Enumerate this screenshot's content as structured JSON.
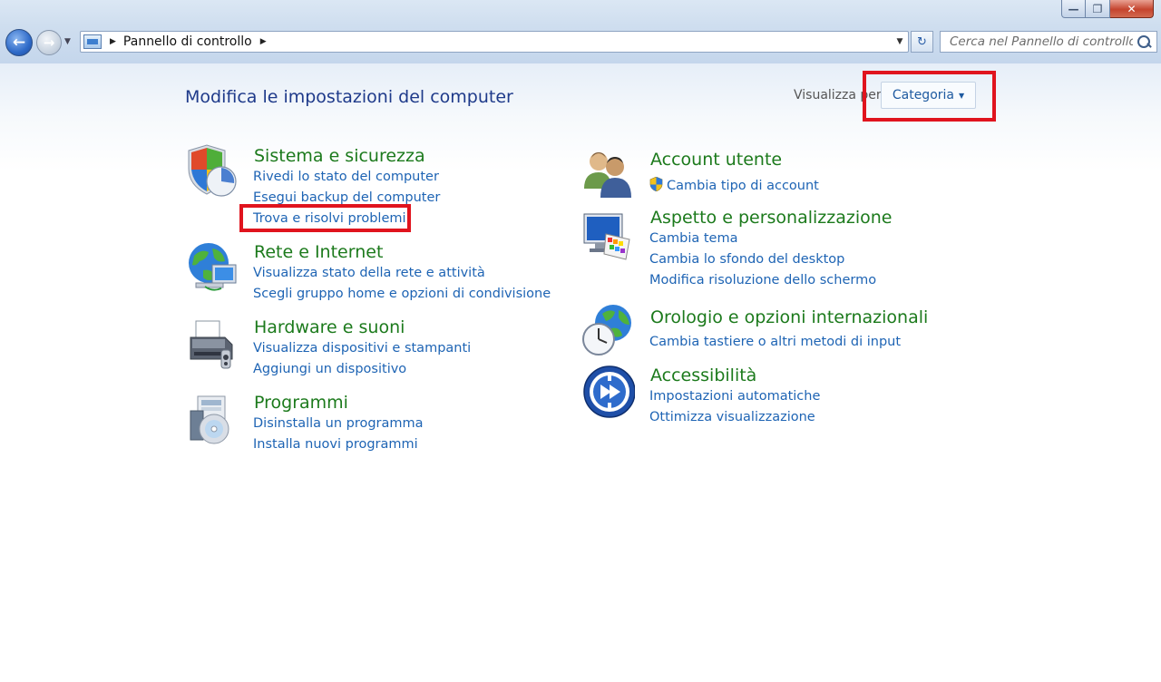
{
  "window": {
    "minimize_glyph": "—",
    "restore_glyph": "❐",
    "close_glyph": "✕"
  },
  "nav": {
    "back_glyph": "←",
    "forward_glyph": "→",
    "recent_glyph": "▼",
    "breadcrumb": "Pannello di controllo",
    "crumb_sep": "▶",
    "dropdown_glyph": "▼",
    "refresh_glyph": "↻",
    "search_placeholder": "Cerca nel Pannello di controllo"
  },
  "header": {
    "title": "Modifica le impostazioni del computer",
    "view_label": "Visualizza per:",
    "view_value": "Categoria",
    "view_caret": "▼"
  },
  "categories_left": [
    {
      "title": "Sistema e sicurezza",
      "icon": "shield-icon",
      "links": [
        "Rivedi lo stato del computer",
        "Esegui backup del computer",
        "Trova e risolvi problemi"
      ]
    },
    {
      "title": "Rete e Internet",
      "icon": "network-globe-icon",
      "links": [
        "Visualizza stato della rete e attività",
        "Scegli gruppo home e opzioni di condivisione"
      ]
    },
    {
      "title": "Hardware e suoni",
      "icon": "printer-icon",
      "links": [
        "Visualizza dispositivi e stampanti",
        "Aggiungi un dispositivo"
      ]
    },
    {
      "title": "Programmi",
      "icon": "programs-disc-icon",
      "links": [
        "Disinstalla un programma",
        "Installa nuovi programmi"
      ]
    }
  ],
  "categories_right": [
    {
      "title": "Account utente",
      "icon": "users-icon",
      "links": [
        "Cambia tipo di account"
      ]
    },
    {
      "title": "Aspetto e personalizzazione",
      "icon": "monitor-palette-icon",
      "links": [
        "Cambia tema",
        "Cambia lo sfondo del desktop",
        "Modifica risoluzione dello schermo"
      ]
    },
    {
      "title": "Orologio e opzioni internazionali",
      "icon": "clock-globe-icon",
      "links": [
        "Cambia tastiere o altri metodi di input"
      ]
    },
    {
      "title": "Accessibilità",
      "icon": "accessibility-icon",
      "links": [
        "Impostazioni automatiche",
        "Ottimizza visualizzazione"
      ]
    }
  ],
  "colors": {
    "category_title": "#1c7a1c",
    "link": "#1e64b4",
    "page_title": "#1e3a8a",
    "highlight_box": "#e0141e"
  }
}
